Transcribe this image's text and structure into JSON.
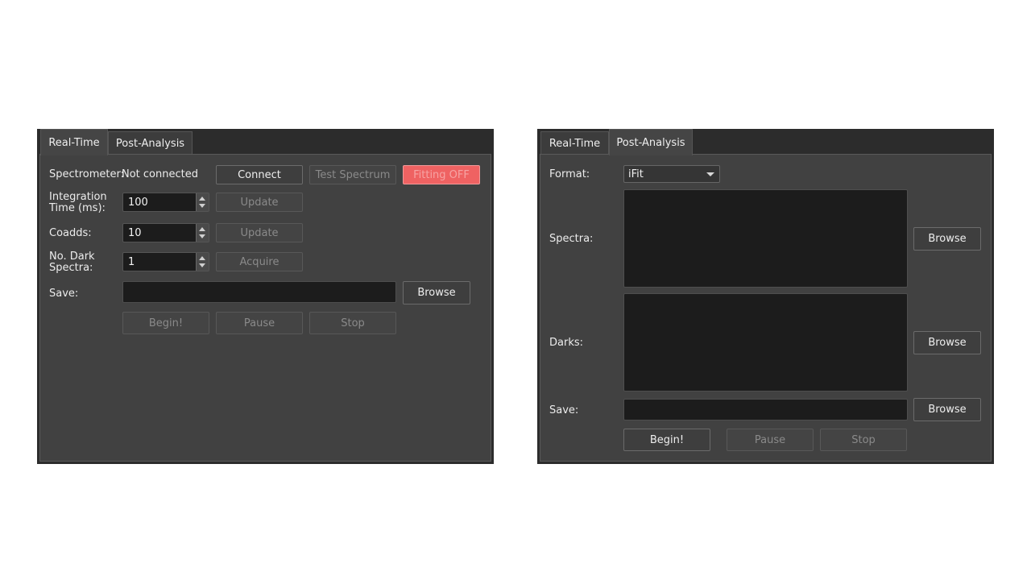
{
  "realtime": {
    "tabs": {
      "realtime": "Real-Time",
      "postanalysis": "Post-Analysis"
    },
    "spectrometer_label": "Spectrometer:",
    "spectrometer_status": "Not connected",
    "connect_label": "Connect",
    "test_spectrum_label": "Test Spectrum",
    "fitting_label": "Fitting OFF",
    "integration_label_1": "Integration",
    "integration_label_2": "Time (ms):",
    "integration_value": "100",
    "update_label": "Update",
    "coadds_label": "Coadds:",
    "coadds_value": "10",
    "dark_label_1": "No. Dark",
    "dark_label_2": "Spectra:",
    "dark_value": "1",
    "acquire_label": "Acquire",
    "save_label": "Save:",
    "browse_label": "Browse",
    "begin_label": "Begin!",
    "pause_label": "Pause",
    "stop_label": "Stop"
  },
  "postanalysis": {
    "tabs": {
      "realtime": "Real-Time",
      "postanalysis": "Post-Analysis"
    },
    "format_label": "Format:",
    "format_value": "iFit",
    "spectra_label": "Spectra:",
    "darks_label": "Darks:",
    "save_label": "Save:",
    "browse_label": "Browse",
    "begin_label": "Begin!",
    "pause_label": "Pause",
    "stop_label": "Stop"
  },
  "colors": {
    "panel_bg": "#414141",
    "field_bg": "#1c1c1c",
    "fitting_off": "#ef6262"
  }
}
